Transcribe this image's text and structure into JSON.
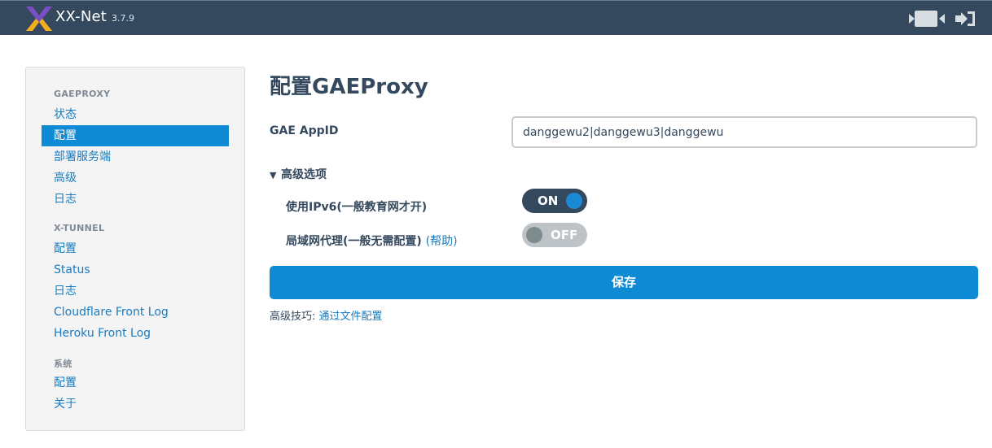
{
  "header": {
    "brand": "XX-Net",
    "version": "3.7.9",
    "icons": [
      "xxnet-logo-icon",
      "camera-icon",
      "sign-out-icon"
    ]
  },
  "sidebar": {
    "sections": [
      {
        "title": "GAEPROXY",
        "items": [
          "状态",
          "配置",
          "部署服务端",
          "高级",
          "日志"
        ]
      },
      {
        "title": "X-TUNNEL",
        "items": [
          "配置",
          "Status",
          "日志",
          "Cloudflare Front Log",
          "Heroku Front Log"
        ]
      },
      {
        "title": "系统",
        "items": [
          "配置",
          "关于"
        ]
      }
    ],
    "active_item": "GAEPROXY/配置"
  },
  "main": {
    "title": "配置GAEProxy",
    "appid_label": "GAE AppID",
    "appid_value": "danggewu2|danggewu3|danggewu",
    "advanced_label": "高级选项",
    "options": [
      {
        "label": "使用IPv6(一般教育网才开)",
        "state": "ON",
        "enabled": true
      },
      {
        "label": "局域网代理(一般无需配置)",
        "help": "(帮助)",
        "state": "OFF",
        "enabled": false
      }
    ],
    "save_label": "保存",
    "tip_prefix": "高级技巧:",
    "tip_link": "通过文件配置"
  },
  "colors": {
    "topbar": "#34495e",
    "accent": "#0f8bd6",
    "link": "#1a7bbf",
    "text": "#34495e"
  }
}
